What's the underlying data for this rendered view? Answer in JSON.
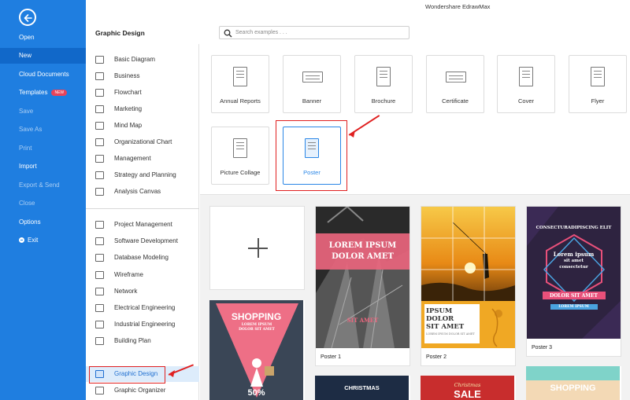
{
  "app": {
    "title": "Wondershare EdrawMax"
  },
  "left_menu": [
    {
      "label": "Open",
      "dim": false,
      "active": false
    },
    {
      "label": "New",
      "dim": false,
      "active": true
    },
    {
      "label": "Cloud Documents",
      "dim": false,
      "active": false
    },
    {
      "label": "Templates",
      "dim": false,
      "active": false,
      "badge": "NEW"
    },
    {
      "label": "Save",
      "dim": true,
      "active": false
    },
    {
      "label": "Save As",
      "dim": true,
      "active": false
    },
    {
      "label": "Print",
      "dim": true,
      "active": false
    },
    {
      "label": "Import",
      "dim": false,
      "active": false
    },
    {
      "label": "Export & Send",
      "dim": true,
      "active": false
    },
    {
      "label": "Close",
      "dim": true,
      "active": false
    },
    {
      "label": "Options",
      "dim": false,
      "active": false
    },
    {
      "label": "Exit",
      "dim": false,
      "active": false
    }
  ],
  "header": {
    "section_title": "Graphic Design",
    "search_placeholder": "Search examples . . ."
  },
  "categories_group1": [
    "Basic Diagram",
    "Business",
    "Flowchart",
    "Marketing",
    "Mind Map",
    "Organizational Chart",
    "Management",
    "Strategy and Planning",
    "Analysis Canvas"
  ],
  "categories_group2": [
    "Project Management",
    "Software Development",
    "Database Modeling",
    "Wireframe",
    "Network",
    "Electrical Engineering",
    "Industrial Engineering",
    "Building Plan",
    "Graphic Design",
    "Graphic Organizer"
  ],
  "selected_category": "Graphic Design",
  "types": [
    "Annual Reports",
    "Banner",
    "Brochure",
    "Certificate",
    "Cover",
    "Flyer",
    "Picture Collage",
    "Poster"
  ],
  "selected_type": "Poster",
  "templates": [
    {
      "name": "Poster 1",
      "lines": [
        "LOREM IPSUM",
        "DOLOR AMET",
        "SIT AMET"
      ]
    },
    {
      "name": "Poster 2",
      "lines": [
        "IPSUM DOLOR",
        "SIT AMET",
        "LOREM IPSUM DOLOR SIT AMET"
      ]
    },
    {
      "name": "Poster 3",
      "lines": [
        "CONSECTURADIPISCING ELIT",
        "Lorem ipsum",
        "sit amet",
        "consectetur",
        "DOLOR SIT AMET",
        "LOREM IPSUM"
      ]
    }
  ],
  "preview_texts": {
    "shopping": "SHOPPING",
    "shopping_sub": "LOREM IPSUM DOLOR SIT AMET",
    "sale_pct": "50%",
    "christmas": "CHRISTMAS",
    "christmas_script": "Christmas",
    "sale": "SALE",
    "shopping2": "SHOPPING"
  },
  "colors": {
    "accent_blue": "#1f7ee0",
    "highlight_red": "#e02020"
  }
}
